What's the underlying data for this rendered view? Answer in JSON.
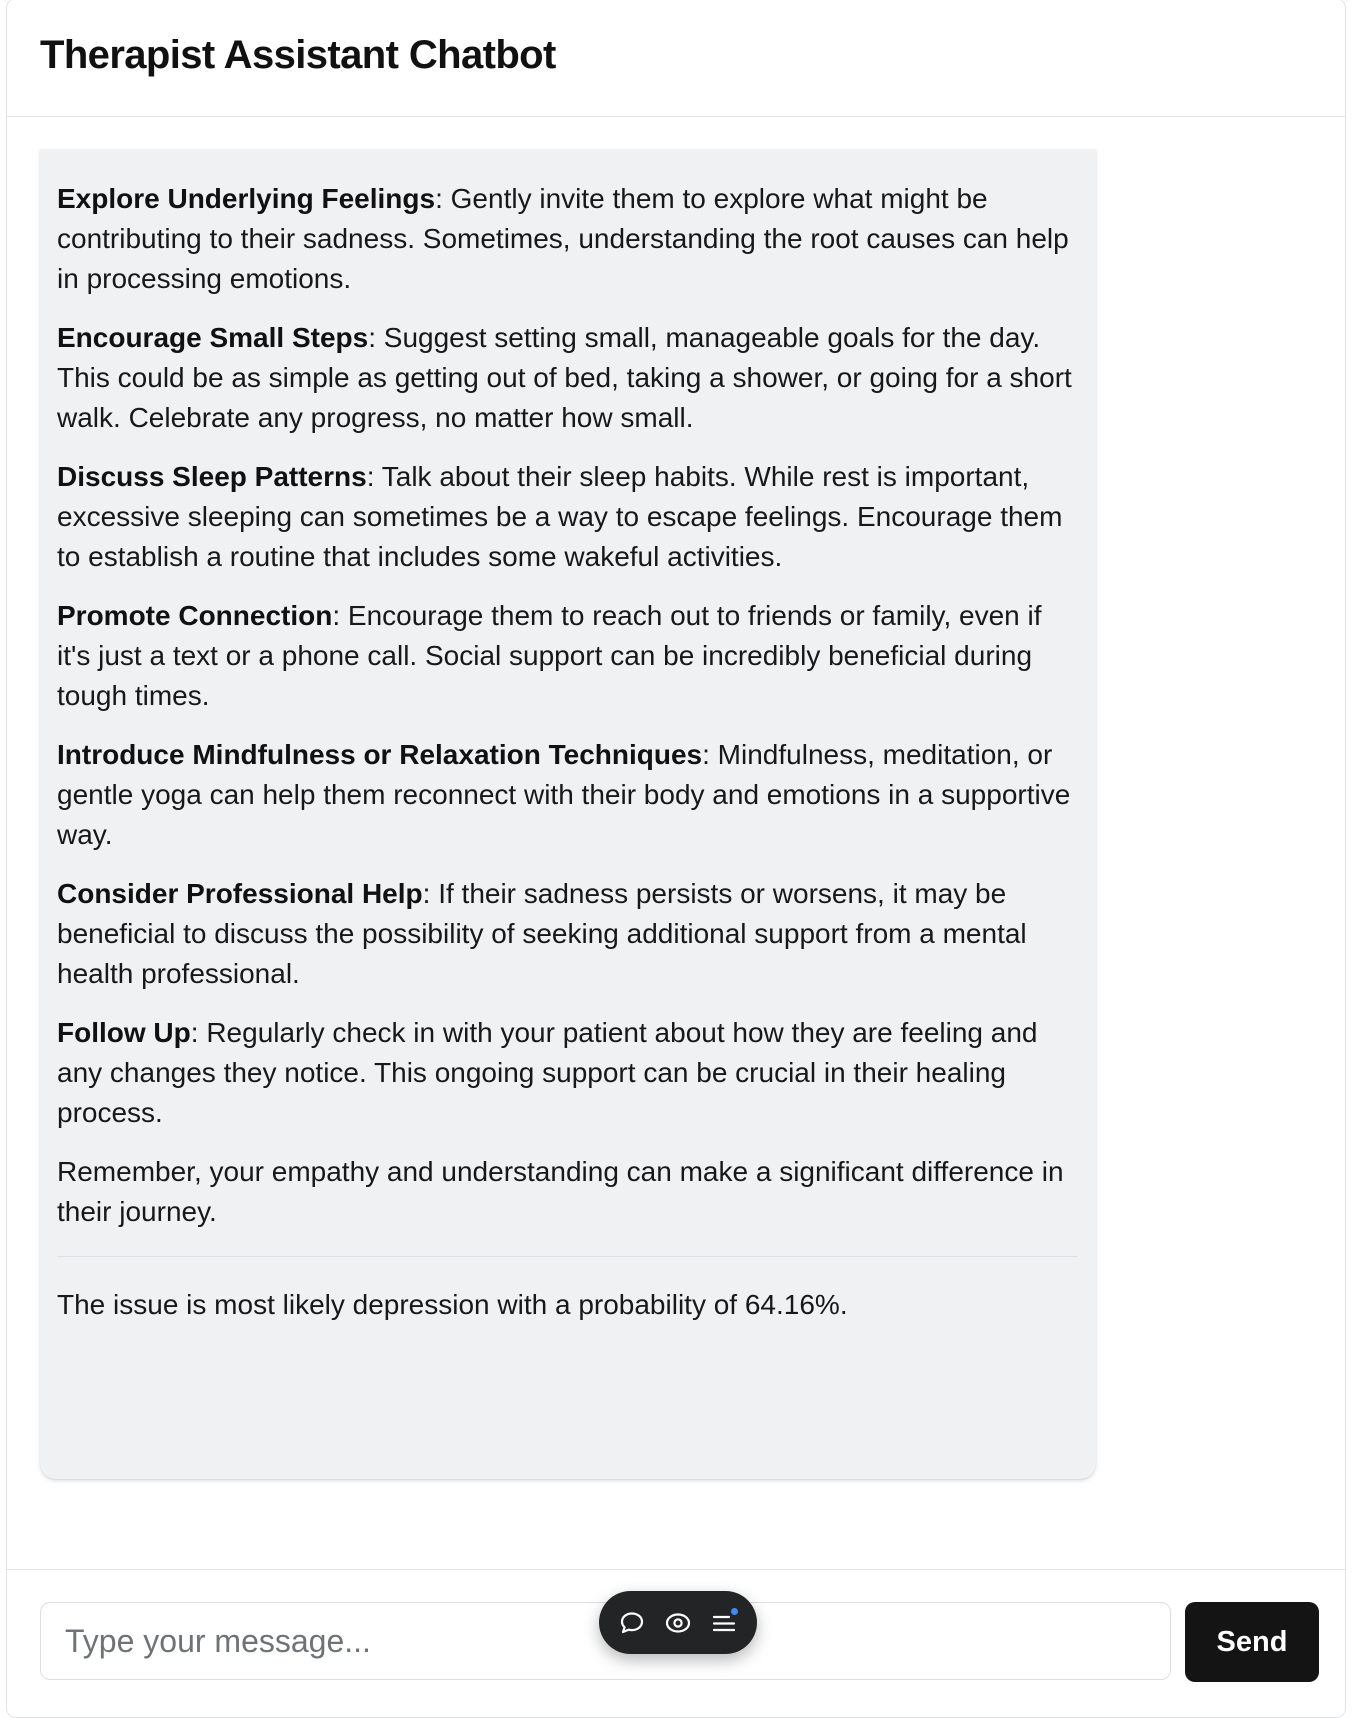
{
  "app": {
    "title": "Therapist Assistant Chatbot"
  },
  "response": {
    "items": [
      {
        "heading": "Explore Underlying Feelings",
        "text": ": Gently invite them to explore what might be contributing to their sadness. Sometimes, understanding the root causes can help in processing emotions."
      },
      {
        "heading": "Encourage Small Steps",
        "text": ": Suggest setting small, manageable goals for the day. This could be as simple as getting out of bed, taking a shower, or going for a short walk. Celebrate any progress, no matter how small."
      },
      {
        "heading": "Discuss Sleep Patterns",
        "text": ": Talk about their sleep habits. While rest is important, excessive sleeping can sometimes be a way to escape feelings. Encourage them to establish a routine that includes some wakeful activities."
      },
      {
        "heading": "Promote Connection",
        "text": ": Encourage them to reach out to friends or family, even if it's just a text or a phone call. Social support can be incredibly beneficial during tough times."
      },
      {
        "heading": "Introduce Mindfulness or Relaxation Techniques",
        "text": ": Mindfulness, meditation, or gentle yoga can help them reconnect with their body and emotions in a supportive way."
      },
      {
        "heading": "Consider Professional Help",
        "text": ": If their sadness persists or worsens, it may be beneficial to discuss the possibility of seeking additional support from a mental health professional."
      },
      {
        "heading": "Follow Up",
        "text": ": Regularly check in with your patient about how they are feeling and any changes they notice. This ongoing support can be crucial in their healing process."
      }
    ],
    "closing": "Remember, your empathy and understanding can make a significant difference in their journey.",
    "prediction": "The issue is most likely depression with a probability of 64.16%."
  },
  "composer": {
    "placeholder": "Type your message...",
    "send_label": "Send"
  },
  "toolbar": {
    "icons": [
      "chat-bubble-icon",
      "eye-icon",
      "list-icon"
    ],
    "notification_color": "#3b8cf6"
  }
}
